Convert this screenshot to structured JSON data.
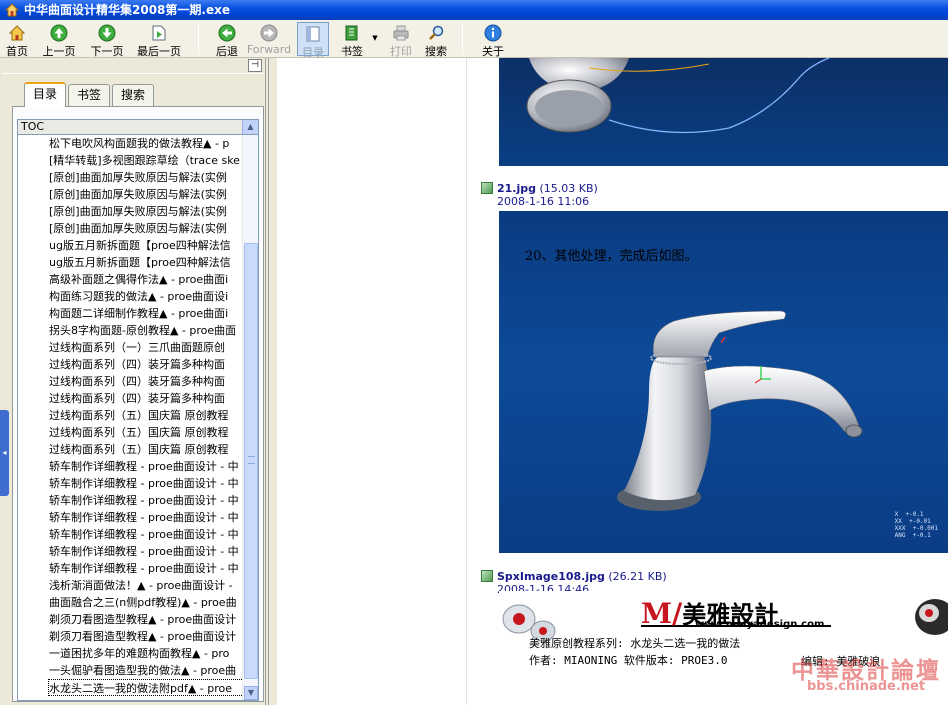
{
  "window": {
    "title": "中华曲面设计精华集2008第一期.exe"
  },
  "toolbar": {
    "home": "首页",
    "prev_page": "上一页",
    "next_page": "下一页",
    "last_page": "最后一页",
    "back": "后退",
    "forward": "Forward",
    "toc": "目录",
    "bookmark": "书签",
    "print": "打印",
    "search": "搜索",
    "about": "关于"
  },
  "tabs": {
    "toc": "目录",
    "bookmarks": "书签",
    "search": "搜索"
  },
  "toc": {
    "header": "TOC",
    "items": [
      "松下电吹风构面题我的做法教程▲ - p",
      "[精华转载]多视图跟踪草绘（trace ske",
      "[原创]曲面加厚失败原因与解法(实例",
      "[原创]曲面加厚失败原因与解法(实例",
      "[原创]曲面加厚失败原因与解法(实例",
      "[原创]曲面加厚失败原因与解法(实例",
      "ug版五月新拆面题【proe四种解法信",
      "ug版五月新拆面题【proe四种解法信",
      "高级补面题之偶得作法▲ - proe曲面i",
      "构面练习题我的做法▲ - proe曲面设i",
      "构面题二详细制作教程▲ - proe曲面i",
      "拐头8字构面题-原创教程▲ - proe曲面",
      "过线构面系列（一）三爪曲面题原创",
      "过线构面系列（四）装牙篇多种构面",
      "过线构面系列（四）装牙篇多种构面",
      "过线构面系列（四）装牙篇多种构面",
      "过线构面系列（五）国庆篇 原创教程",
      "过线构面系列（五）国庆篇 原创教程",
      "过线构面系列（五）国庆篇 原创教程",
      "轿车制作详细教程 - proe曲面设计 - 中",
      "轿车制作详细教程 - proe曲面设计 - 中",
      "轿车制作详细教程 - proe曲面设计 - 中",
      "轿车制作详细教程 - proe曲面设计 - 中",
      "轿车制作详细教程 - proe曲面设计 - 中",
      "轿车制作详细教程 - proe曲面设计 - 中",
      "轿车制作详细教程 - proe曲面设计 - 中",
      "浅析渐消面做法！▲ - proe曲面设计 -",
      "曲面融合之三(n侧pdf教程)▲ - proe曲",
      "剃须刀看图造型教程▲ - proe曲面设计",
      "剃须刀看图造型教程▲ - proe曲面设计",
      "一道困扰多年的难题构面教程▲ - pro",
      "一头倔驴看图造型我的做法▲ - proe曲",
      "水龙头二选一我的做法附pdf▲ - proe"
    ]
  },
  "content": {
    "image1": {
      "filename": "21.jpg",
      "size": "(15.03 KB)",
      "date": "2008-1-16 11:06",
      "caption": "20、其他处理，完成后如图。",
      "readout": "X  +-0.1\nXX  +-0.01\nXXX  +-0.001\nANG  +-0.1"
    },
    "image2": {
      "filename": "SpxImage108.jpg",
      "size": "(26.21 KB)",
      "date": "2008-1-16 14:46",
      "logo": "美雅設計",
      "logo_url": "www.meiyadesign.com",
      "series": "美雅原创教程系列:   水龙头二选一我的做法",
      "author": "作者: MIAONING    软件版本: PROE3.0",
      "editor": "编辑: 美雅破浪",
      "watermark": "中華設計論壇",
      "watermark_url": "bbs.chinade.net"
    }
  }
}
